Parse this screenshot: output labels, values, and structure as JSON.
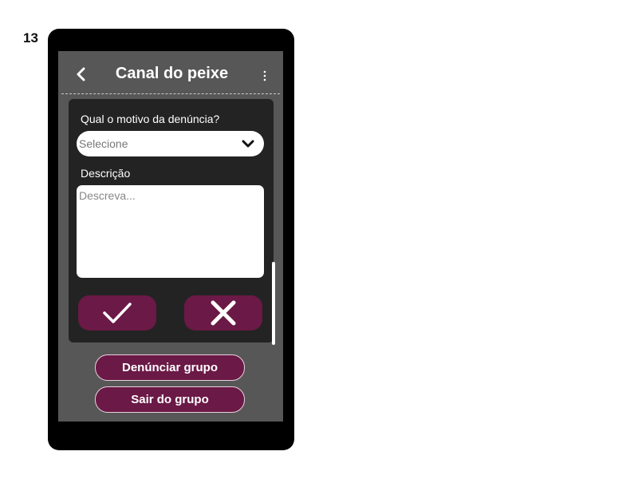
{
  "frame_number": "13",
  "header": {
    "title": "Canal do peixe",
    "back_icon": "chevron-left-icon",
    "menu_icon": "vertical-dots-icon"
  },
  "report_modal": {
    "reason_label": "Qual o motivo da denúncia?",
    "reason_select": {
      "value": "Selecione",
      "icon": "chevron-down-icon"
    },
    "description_label": "Descrição",
    "description_placeholder": "Descreva...",
    "confirm_icon": "checkmark-icon",
    "cancel_icon": "close-icon"
  },
  "actions": {
    "report_group": "Denúnciar grupo",
    "leave_group": "Sair do grupo"
  },
  "colors": {
    "phone_frame": "#000000",
    "screen_bg": "#575757",
    "modal_bg": "#232323",
    "accent": "#6b1946",
    "text": "#ffffff"
  }
}
